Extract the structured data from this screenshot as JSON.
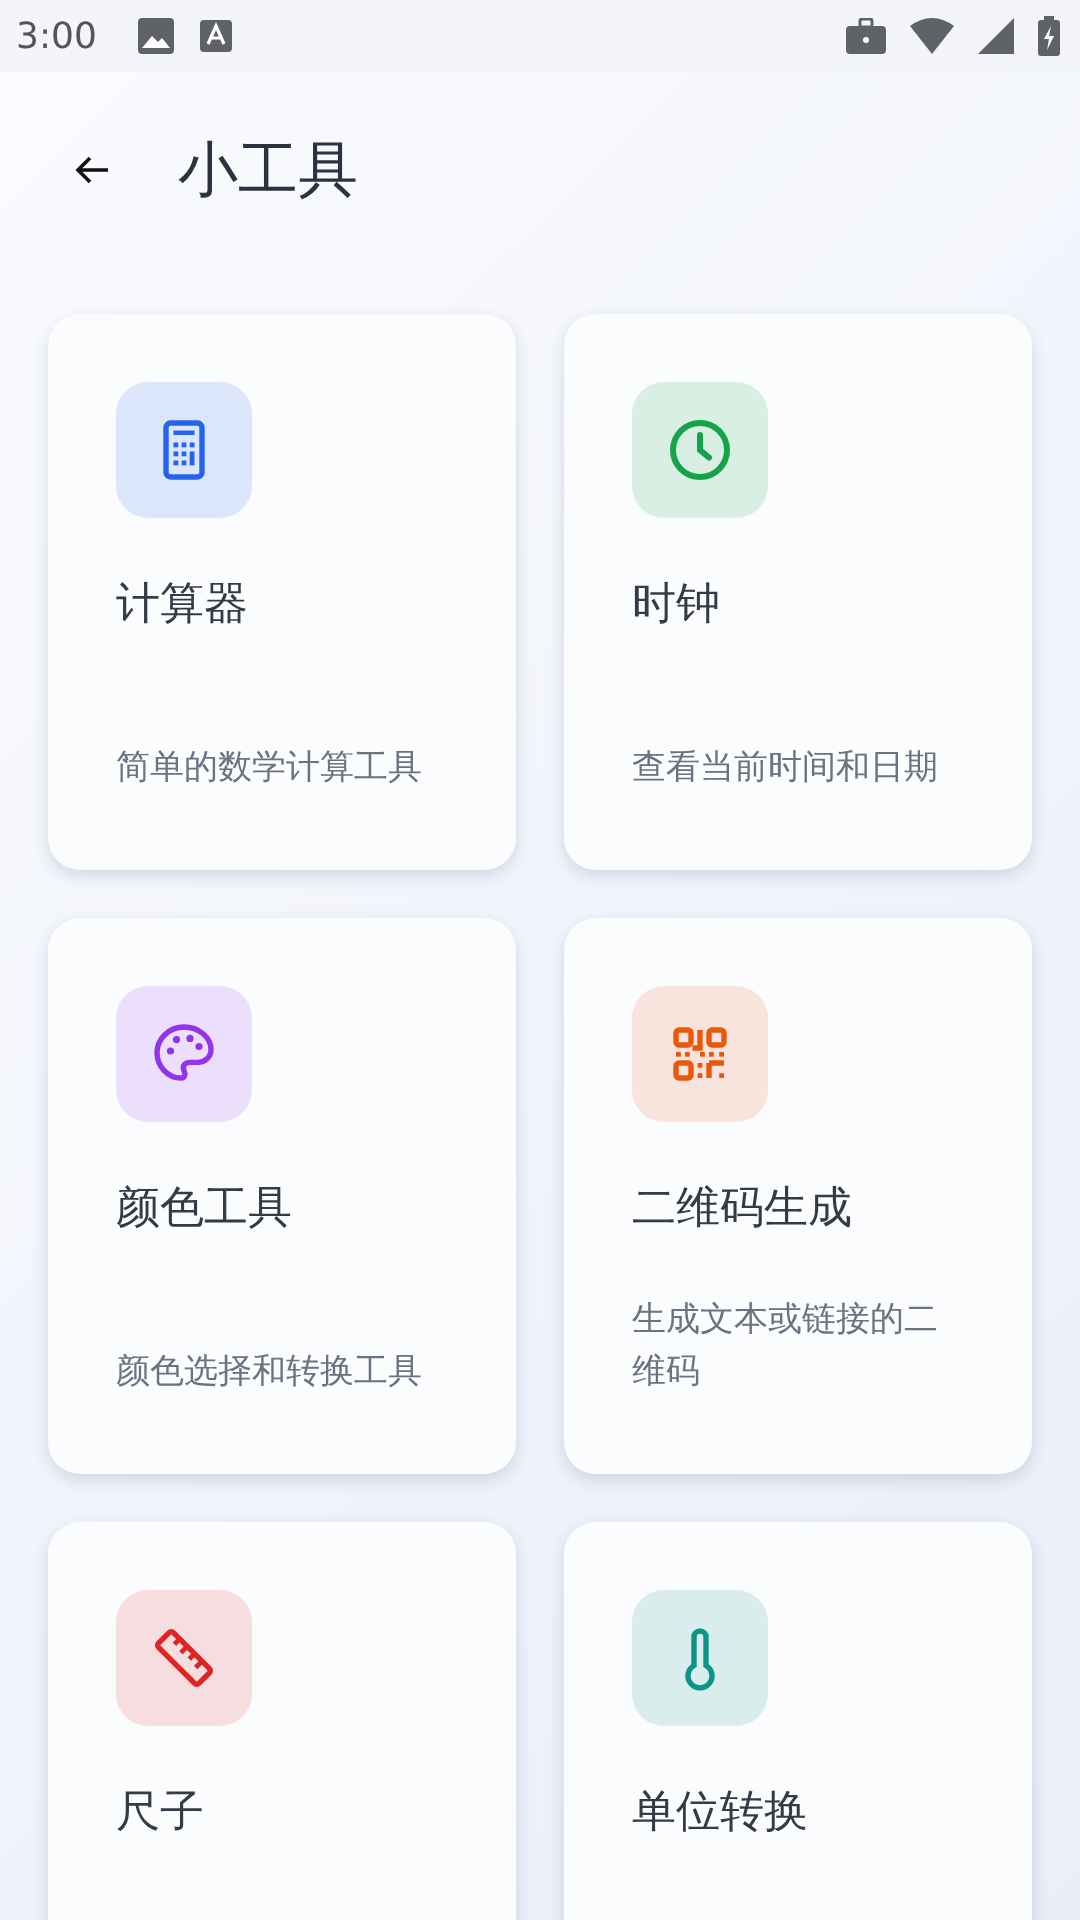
{
  "status_bar": {
    "time": "3:00"
  },
  "header": {
    "title": "小工具"
  },
  "tools": [
    {
      "kind": "calculator",
      "color": "#2563eb",
      "title": "计算器",
      "description": "简单的数学计算工具"
    },
    {
      "kind": "clock",
      "color": "#16a34a",
      "title": "时钟",
      "description": "查看当前时间和日期"
    },
    {
      "kind": "palette",
      "color": "#9333ea",
      "title": "颜色工具",
      "description": "颜色选择和转换工具"
    },
    {
      "kind": "qr",
      "color": "#ea580c",
      "title": "二维码生成",
      "description": "生成文本或链接的二维码"
    },
    {
      "kind": "ruler",
      "color": "#dc2626",
      "title": "尺子"
    },
    {
      "kind": "thermometer",
      "color": "#0d9488",
      "title": "单位转换"
    }
  ]
}
